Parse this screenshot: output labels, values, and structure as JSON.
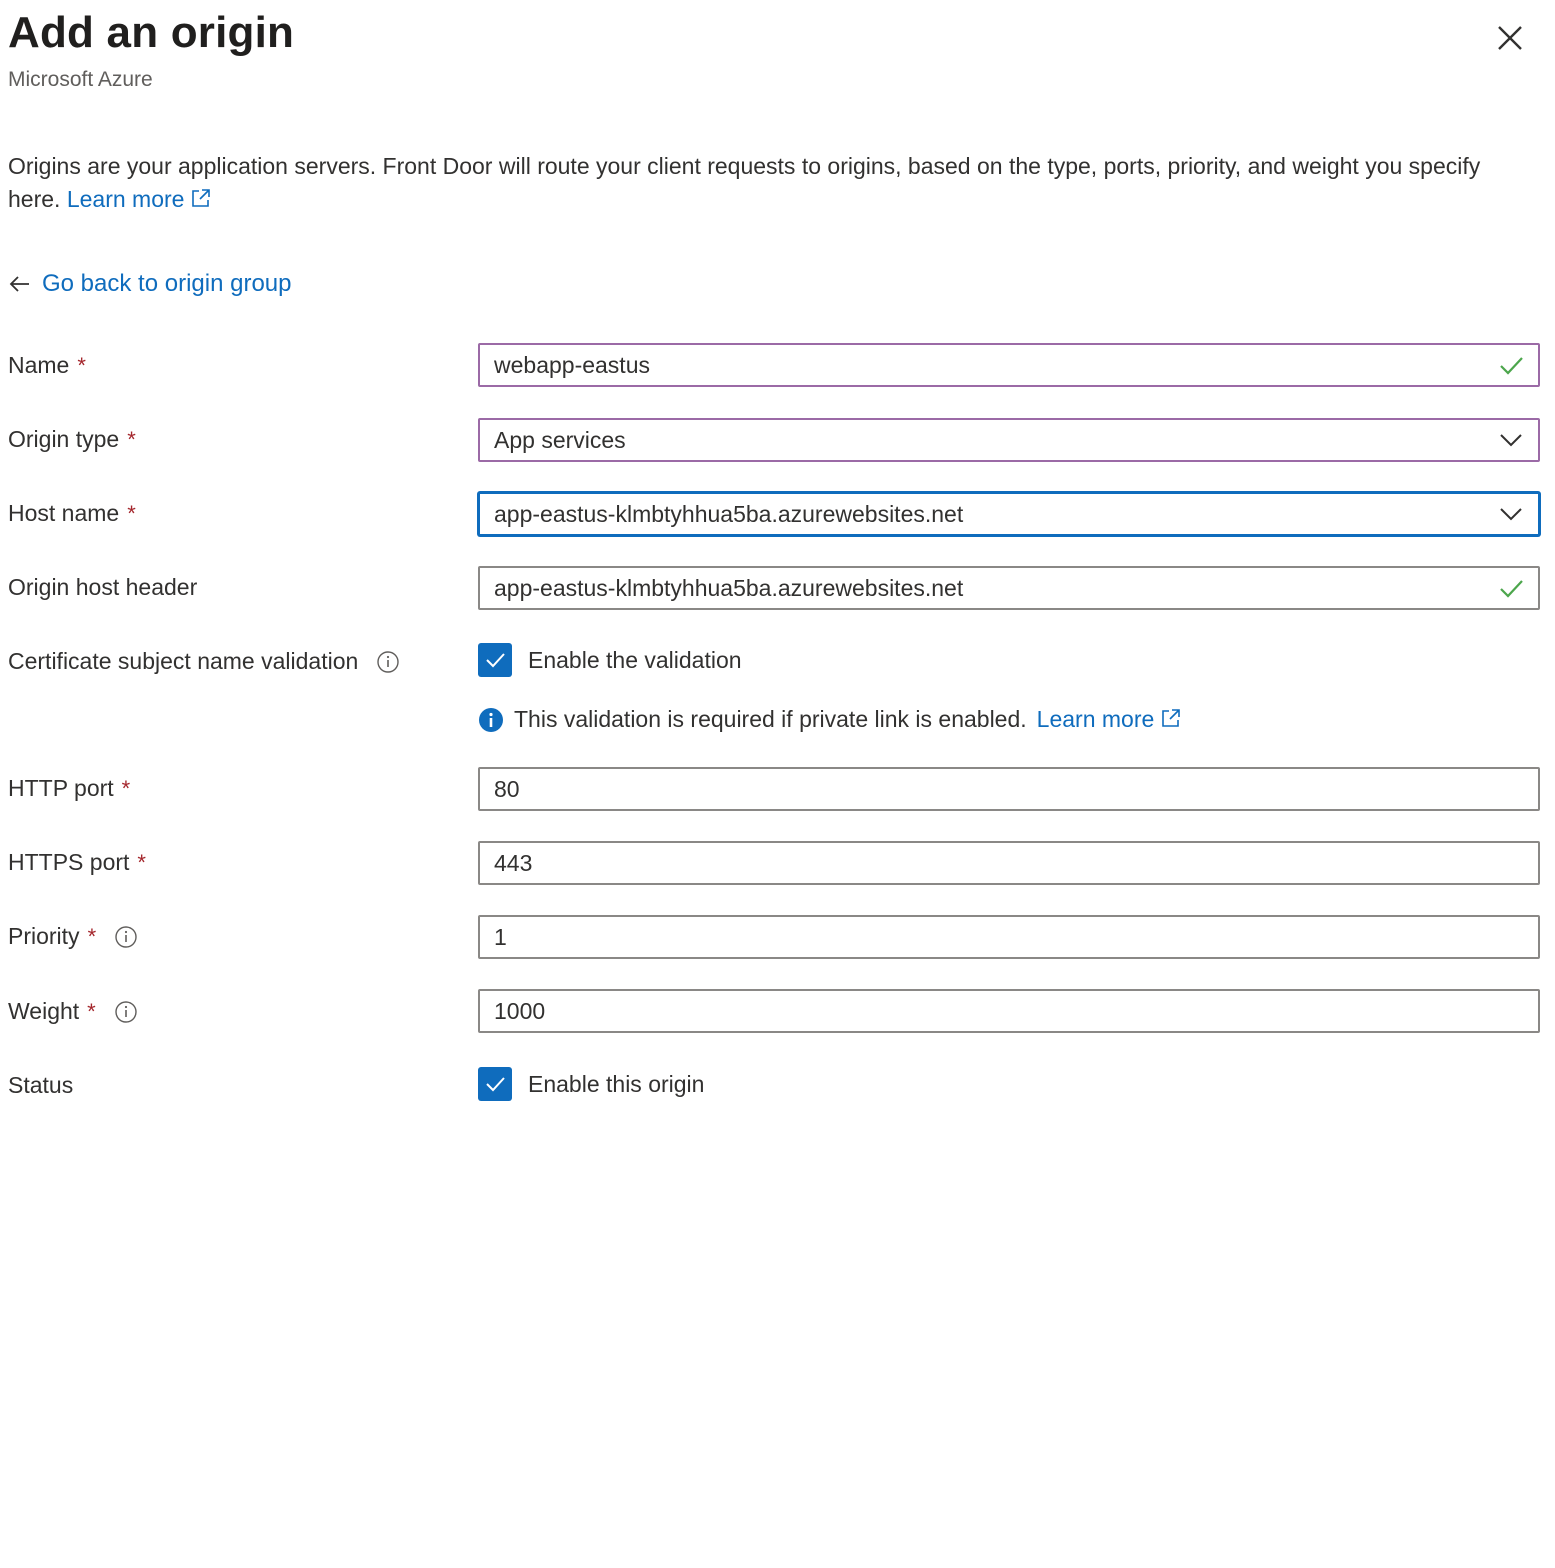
{
  "header": {
    "title": "Add an origin",
    "subtitle": "Microsoft Azure"
  },
  "description": {
    "text": "Origins are your application servers. Front Door will route your client requests to origins, based on the type, ports, priority, and weight you specify here.",
    "learn_more": "Learn more"
  },
  "back_link": "Go back to origin group",
  "form": {
    "name": {
      "label": "Name",
      "required": "*",
      "value": "webapp-eastus"
    },
    "origin_type": {
      "label": "Origin type",
      "required": "*",
      "value": "App services"
    },
    "host_name": {
      "label": "Host name",
      "required": "*",
      "value": "app-eastus-klmbtyhhua5ba.azurewebsites.net"
    },
    "origin_host_header": {
      "label": "Origin host header",
      "value": "app-eastus-klmbtyhhua5ba.azurewebsites.net"
    },
    "cert_validation": {
      "label": "Certificate subject name validation",
      "checkbox_label": "Enable the validation",
      "checked": true,
      "note": "This validation is required if private link is enabled.",
      "note_link": "Learn more"
    },
    "http_port": {
      "label": "HTTP port",
      "required": "*",
      "value": "80"
    },
    "https_port": {
      "label": "HTTPS port",
      "required": "*",
      "value": "443"
    },
    "priority": {
      "label": "Priority",
      "required": "*",
      "value": "1"
    },
    "weight": {
      "label": "Weight",
      "required": "*",
      "value": "1000"
    },
    "status": {
      "label": "Status",
      "checkbox_label": "Enable this origin",
      "checked": true
    }
  },
  "colors": {
    "accent": "#0f6cbd",
    "required": "#a4262c",
    "valid_check": "#4ca64c",
    "field_border": "#8a8886",
    "hover_border": "#9b6aa6"
  }
}
